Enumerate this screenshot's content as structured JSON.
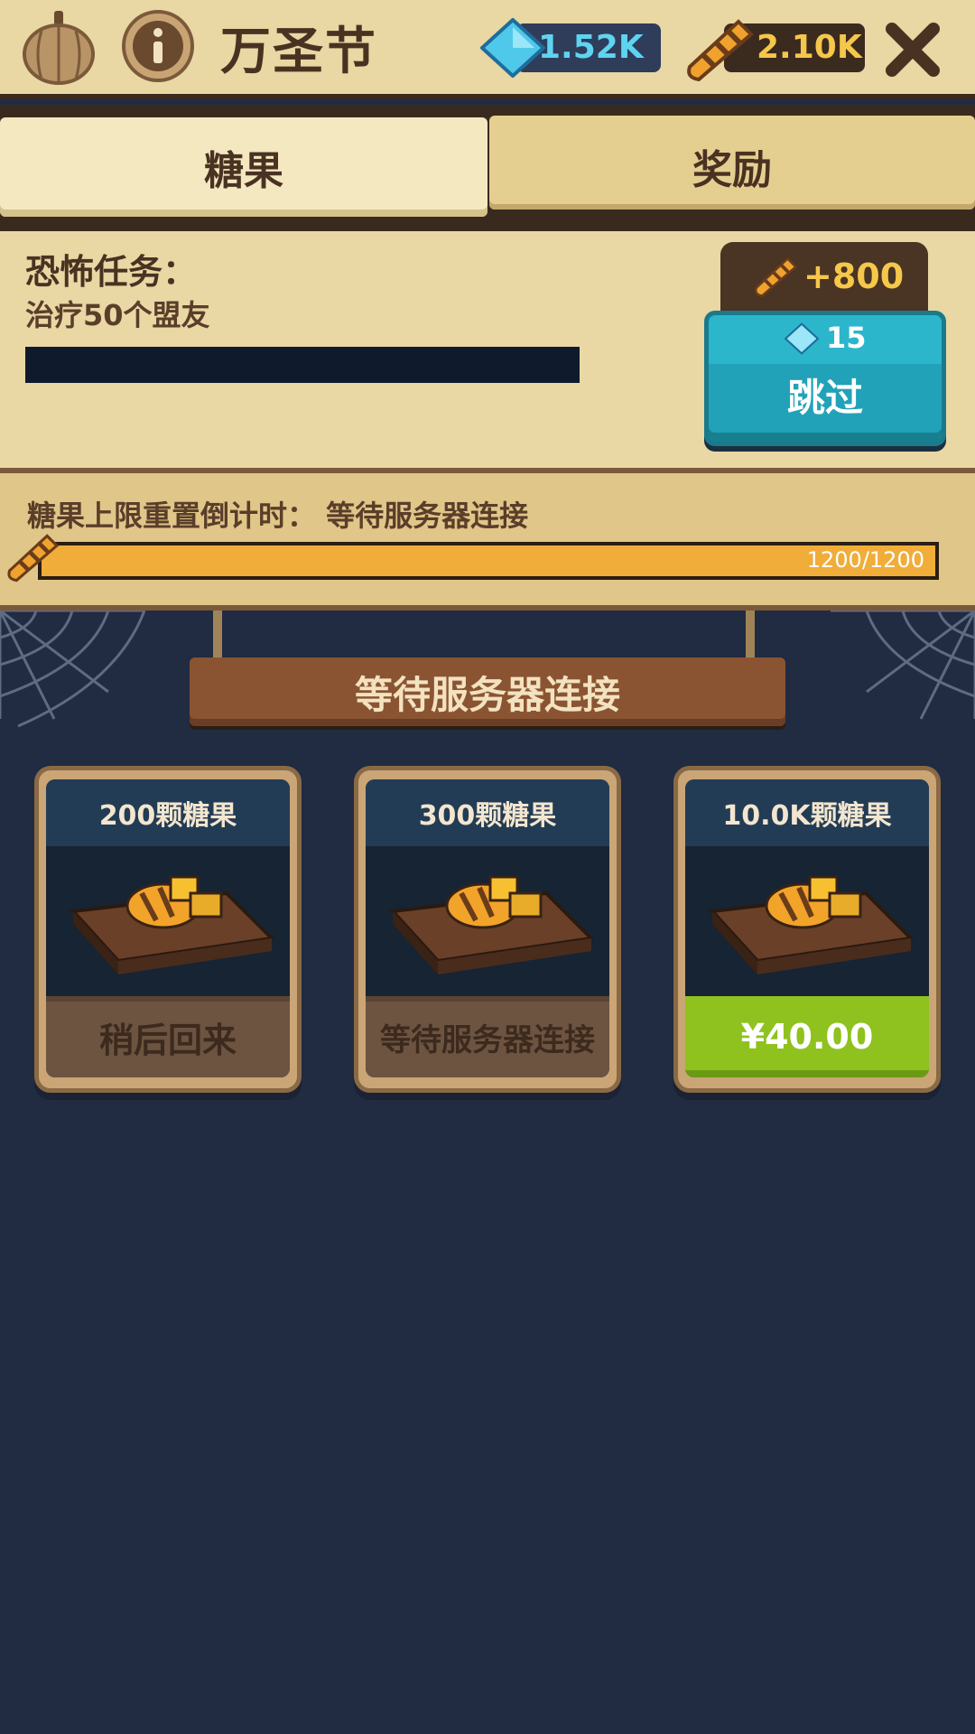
{
  "header": {
    "title": "万圣节",
    "gems": "1.52K",
    "candy": "2.10K"
  },
  "tabs": [
    {
      "label": "糖果",
      "active": true
    },
    {
      "label": "奖励",
      "active": false
    }
  ],
  "quest": {
    "title": "恐怖任务：",
    "description": "治疗50个盟友",
    "reward": "+800",
    "skip_cost": "15",
    "skip_label": "跳过"
  },
  "countdown": {
    "label": "糖果上限重置倒计时： 等待服务器连接",
    "progress_text": "1200/1200",
    "progress": 1.0
  },
  "sign": {
    "text": "等待服务器连接"
  },
  "offers": [
    {
      "title": "200颗糖果",
      "button": "稍后回来",
      "state": "disabled"
    },
    {
      "title": "300颗糖果",
      "button": "等待服务器连接",
      "state": "waiting"
    },
    {
      "title": "10.0K颗糖果",
      "button": "¥40.00",
      "state": "buy"
    }
  ],
  "colors": {
    "background": "#212b42",
    "parchment": "#e9d7a4",
    "gem_text": "#5fd4f0",
    "candy_text": "#f5c74a",
    "skip_button": "#22a2b8",
    "buy_button": "#8fc21e"
  }
}
